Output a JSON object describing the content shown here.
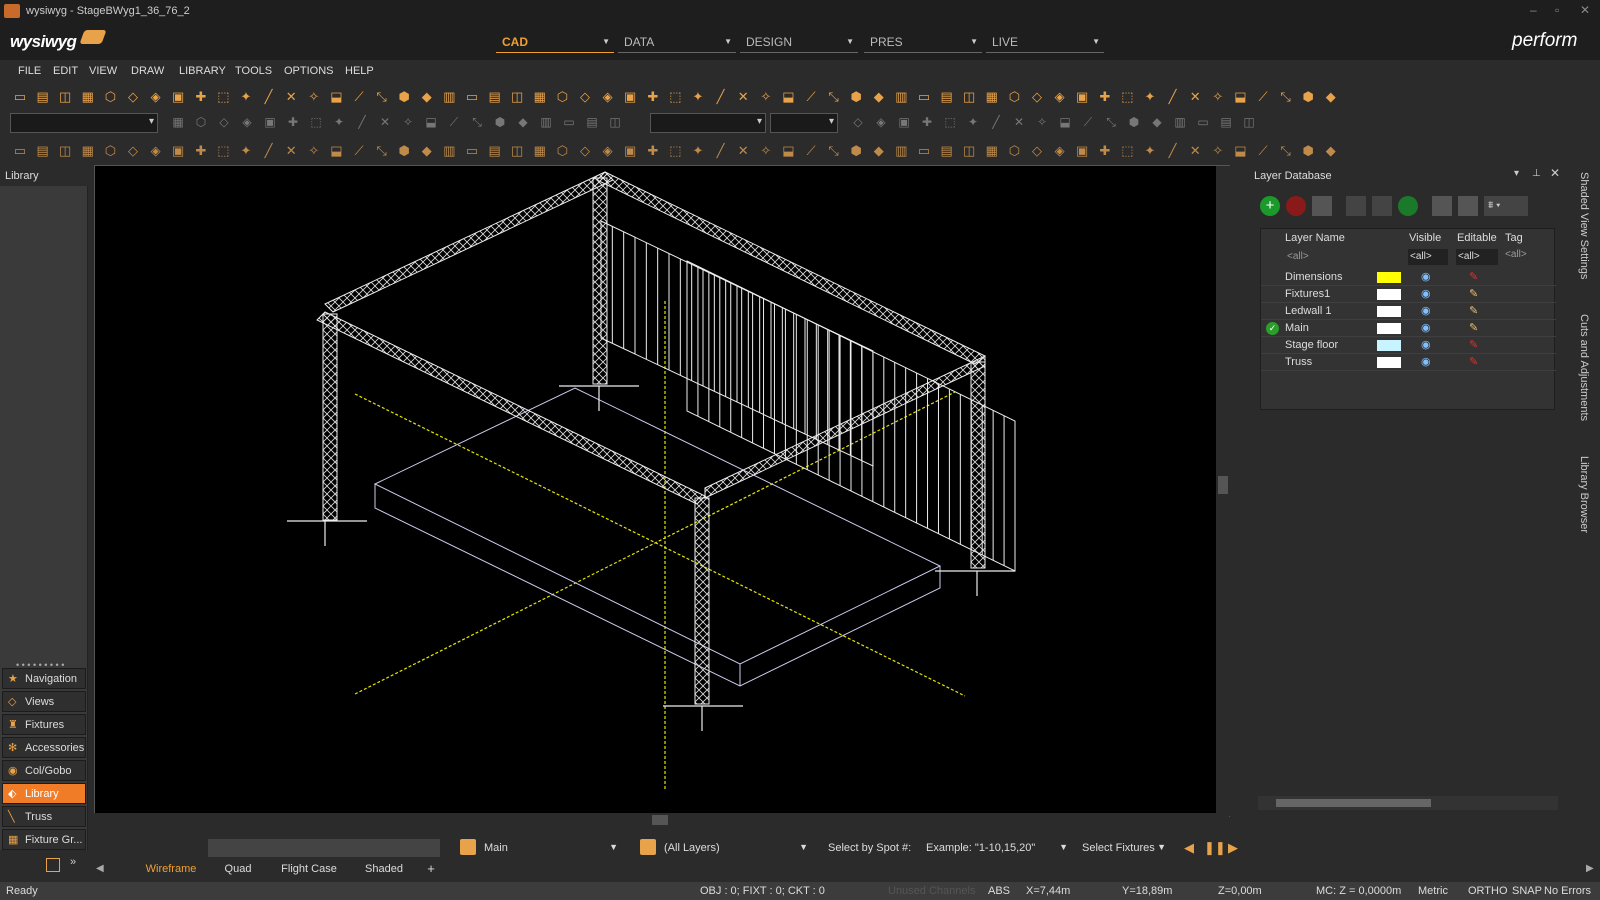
{
  "window": {
    "title": "wysiwyg - StageBWyg1_36_76_2"
  },
  "app": {
    "logo": "wysiwyg",
    "brand": "perform"
  },
  "modes": [
    {
      "label": "CAD",
      "active": true
    },
    {
      "label": "DATA",
      "active": false
    },
    {
      "label": "DESIGN",
      "active": false
    },
    {
      "label": "PRES",
      "active": false
    },
    {
      "label": "LIVE",
      "active": false
    }
  ],
  "menu": [
    "FILE",
    "EDIT",
    "VIEW",
    "DRAW",
    "LIBRARY",
    "TOOLS",
    "OPTIONS",
    "HELP"
  ],
  "left_panel": {
    "header": "Library",
    "nav": [
      {
        "label": "Navigation",
        "icon": "star-icon",
        "active": false
      },
      {
        "label": "Views",
        "icon": "views-icon",
        "active": false
      },
      {
        "label": "Fixtures",
        "icon": "fixture-icon",
        "active": false
      },
      {
        "label": "Accessories",
        "icon": "accessory-icon",
        "active": false
      },
      {
        "label": "Col/Gobo",
        "icon": "gobo-icon",
        "active": false
      },
      {
        "label": "Library",
        "icon": "library-icon",
        "active": true
      },
      {
        "label": "Truss",
        "icon": "truss-icon",
        "active": false
      },
      {
        "label": "Fixture Gr...",
        "icon": "fixture-group-icon",
        "active": false
      }
    ]
  },
  "layer_db": {
    "title": "Layer Database",
    "columns": [
      "Layer Name",
      "Visible",
      "Editable",
      "Tag"
    ],
    "filters": {
      "name": "<all>",
      "visible": "<all>",
      "editable": "<all>",
      "tag": "<all>"
    },
    "rows": [
      {
        "name": "Dimensions",
        "color": "#ffff00",
        "current": false,
        "editable": false
      },
      {
        "name": "Fixtures1",
        "color": "#ffffff",
        "current": false,
        "editable": true
      },
      {
        "name": "Ledwall 1",
        "color": "#ffffff",
        "current": false,
        "editable": true
      },
      {
        "name": "Main",
        "color": "#ffffff",
        "current": true,
        "editable": true
      },
      {
        "name": "Stage floor",
        "color": "#c8f4ff",
        "current": false,
        "editable": false
      },
      {
        "name": "Truss",
        "color": "#ffffff",
        "current": false,
        "editable": false
      }
    ]
  },
  "side_tabs": [
    "Shaded View Settings",
    "Cuts and Adjustments",
    "Library Browser"
  ],
  "bottom": {
    "layer": "Main",
    "all_layers": "(All Layers)",
    "select_by_spot_label": "Select by Spot #:",
    "spot_example": "Example: \"1-10,15,20\"",
    "select_fixtures": "Select Fixtures",
    "view_tabs": [
      {
        "label": "Wireframe",
        "active": true
      },
      {
        "label": "Quad",
        "active": false
      },
      {
        "label": "Flight Case",
        "active": false
      },
      {
        "label": "Shaded",
        "active": false
      },
      {
        "label": "+",
        "active": false
      }
    ]
  },
  "status": {
    "ready": "Ready",
    "counts": "OBJ : 0; FIXT : 0; CKT : 0",
    "unused": "Unused Channels",
    "abs": "ABS",
    "x": "X=7,44m",
    "y": "Y=18,89m",
    "z": "Z=0,00m",
    "mc": "MC: Z = 0,0000m",
    "units": "Metric",
    "ortho": "ORTHO",
    "snap": "SNAP",
    "errors": "No Errors"
  }
}
